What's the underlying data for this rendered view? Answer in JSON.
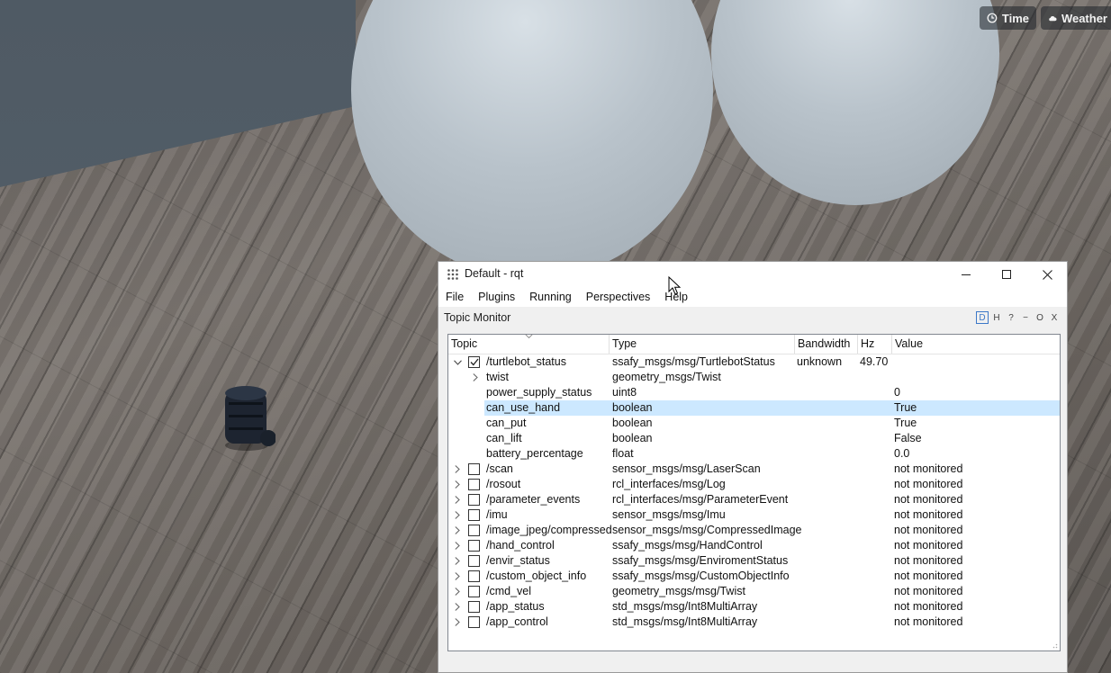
{
  "scene": {
    "time_label": "Time",
    "weather_label": "Weather"
  },
  "window": {
    "title": "Default - rqt",
    "menu": [
      "File",
      "Plugins",
      "Running",
      "Perspectives",
      "Help"
    ]
  },
  "panel": {
    "title": "Topic Monitor",
    "dock_buttons": [
      "D",
      "H",
      "?",
      "−",
      "O",
      "X"
    ]
  },
  "table": {
    "columns": [
      "Topic",
      "Type",
      "Bandwidth",
      "Hz",
      "Value"
    ],
    "rows": [
      {
        "topic": "/turtlebot_status",
        "type": "ssafy_msgs/msg/TurtlebotStatus",
        "bandwidth": "unknown",
        "hz": "49.70",
        "value": "",
        "level": 0,
        "expanded": true,
        "checked": true
      },
      {
        "topic": "twist",
        "type": "geometry_msgs/Twist",
        "bandwidth": "",
        "hz": "",
        "value": "",
        "level": 1,
        "has_children": true
      },
      {
        "topic": "power_supply_status",
        "type": "uint8",
        "bandwidth": "",
        "hz": "",
        "value": "0",
        "level": 1
      },
      {
        "topic": "can_use_hand",
        "type": "boolean",
        "bandwidth": "",
        "hz": "",
        "value": "True",
        "level": 1,
        "selected": true
      },
      {
        "topic": "can_put",
        "type": "boolean",
        "bandwidth": "",
        "hz": "",
        "value": "True",
        "level": 1
      },
      {
        "topic": "can_lift",
        "type": "boolean",
        "bandwidth": "",
        "hz": "",
        "value": "False",
        "level": 1
      },
      {
        "topic": "battery_percentage",
        "type": "float",
        "bandwidth": "",
        "hz": "",
        "value": "0.0",
        "level": 1
      },
      {
        "topic": "/scan",
        "type": "sensor_msgs/msg/LaserScan",
        "value": "not monitored",
        "level": 0
      },
      {
        "topic": "/rosout",
        "type": "rcl_interfaces/msg/Log",
        "value": "not monitored",
        "level": 0
      },
      {
        "topic": "/parameter_events",
        "type": "rcl_interfaces/msg/ParameterEvent",
        "value": "not monitored",
        "level": 0
      },
      {
        "topic": "/imu",
        "type": "sensor_msgs/msg/Imu",
        "value": "not monitored",
        "level": 0
      },
      {
        "topic": "/image_jpeg/compressed",
        "type": "sensor_msgs/msg/CompressedImage",
        "value": "not monitored",
        "level": 0
      },
      {
        "topic": "/hand_control",
        "type": "ssafy_msgs/msg/HandControl",
        "value": "not monitored",
        "level": 0
      },
      {
        "topic": "/envir_status",
        "type": "ssafy_msgs/msg/EnviromentStatus",
        "value": "not monitored",
        "level": 0
      },
      {
        "topic": "/custom_object_info",
        "type": "ssafy_msgs/msg/CustomObjectInfo",
        "value": "not monitored",
        "level": 0
      },
      {
        "topic": "/cmd_vel",
        "type": "geometry_msgs/msg/Twist",
        "value": "not monitored",
        "level": 0
      },
      {
        "topic": "/app_status",
        "type": "std_msgs/msg/Int8MultiArray",
        "value": "not monitored",
        "level": 0
      },
      {
        "topic": "/app_control",
        "type": "std_msgs/msg/Int8MultiArray",
        "value": "not monitored",
        "level": 0
      }
    ]
  }
}
